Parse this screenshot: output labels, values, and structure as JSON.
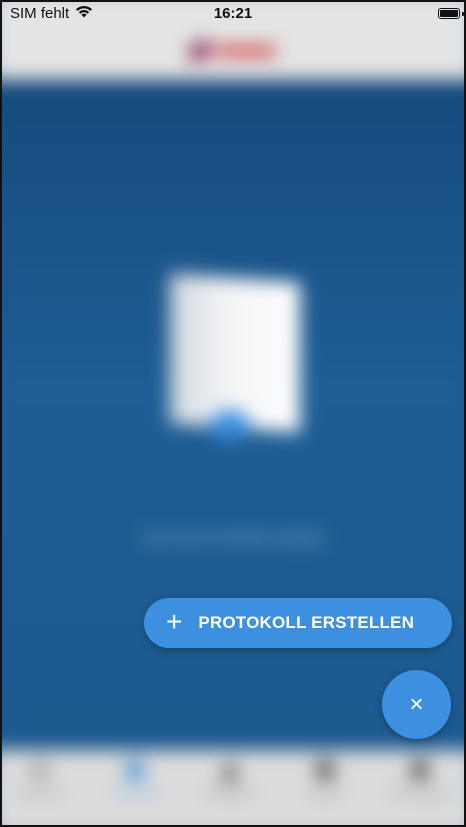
{
  "status_bar": {
    "carrier": "SIM fehlt",
    "wifi_icon": "wifi-icon",
    "time": "16:21",
    "battery_icon": "battery-icon"
  },
  "app": {
    "brand_logo": "brand-logo",
    "empty_message": "Noch keine Protokolle angelegt",
    "tabs": [
      {
        "label": "Startseite",
        "icon": "grid-icon",
        "active": false
      },
      {
        "label": "Protokolle",
        "icon": "document-icon",
        "active": true
      },
      {
        "label": "Meldungen",
        "icon": "warning-icon",
        "active": false
      },
      {
        "label": "Support",
        "icon": "help-icon",
        "active": false
      },
      {
        "label": "Einstellungen",
        "icon": "gear-icon",
        "active": false
      }
    ]
  },
  "fab_menu": {
    "create_icon": "plus-icon",
    "create_label": "PROTOKOLL ERSTELLEN",
    "close_icon": "close-icon",
    "close_glyph": "×"
  },
  "colors": {
    "accent": "#3d8fe0",
    "background": "#1d5a92"
  }
}
